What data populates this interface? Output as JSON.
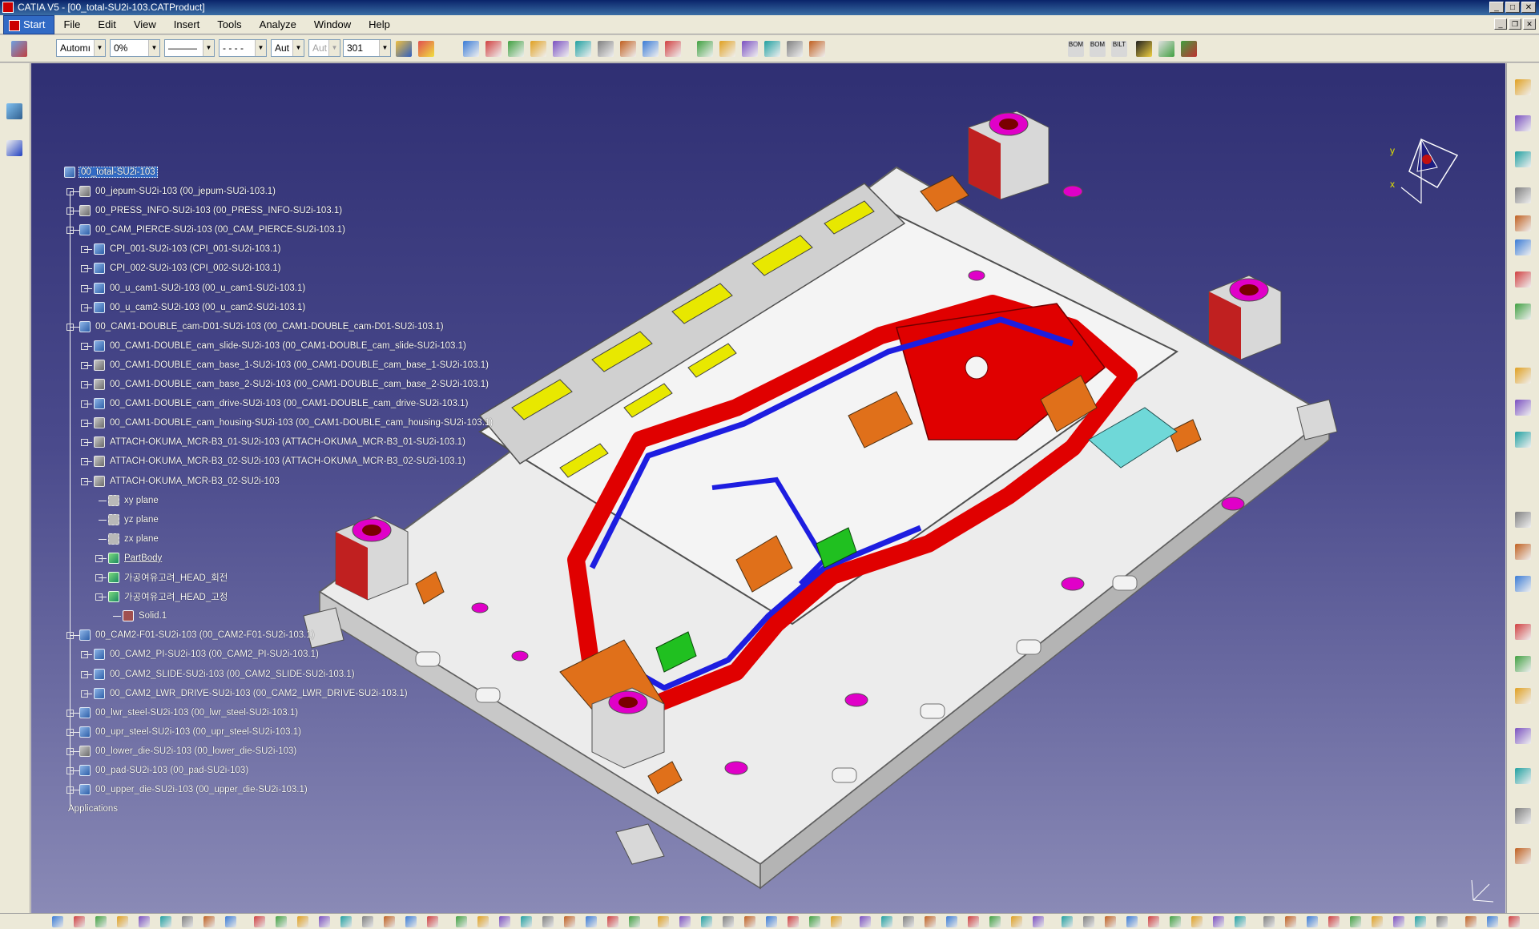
{
  "window": {
    "title": "CATIA V5 - [00_total-SU2i-103.CATProduct]"
  },
  "menu": [
    {
      "label": "Start"
    },
    {
      "label": "File"
    },
    {
      "label": "Edit"
    },
    {
      "label": "View"
    },
    {
      "label": "Insert"
    },
    {
      "label": "Tools"
    },
    {
      "label": "Analyze"
    },
    {
      "label": "Window"
    },
    {
      "label": "Help"
    }
  ],
  "toolbar": {
    "color_value": "Automı",
    "transparency_value": "0%",
    "linetype_value": "———",
    "linedash_value": "- - - -",
    "lineweight_value": "Aut",
    "point_value": "Aut",
    "layer_value": "301",
    "bom_labels": [
      "BOM",
      "BOM",
      "BILT"
    ]
  },
  "tree": {
    "root": "00_total-SU2i-103",
    "nodes": [
      {
        "label": "00_jepum-SU2i-103 (00_jepum-SU2i-103.1)",
        "icon": "part"
      },
      {
        "label": "00_PRESS_INFO-SU2i-103 (00_PRESS_INFO-SU2i-103.1)",
        "icon": "part"
      },
      {
        "label": "00_CAM_PIERCE-SU2i-103 (00_CAM_PIERCE-SU2i-103.1)",
        "icon": "prod"
      },
      {
        "label": "CPI_001-SU2i-103 (CPI_001-SU2i-103.1)",
        "icon": "prod"
      },
      {
        "label": "CPI_002-SU2i-103 (CPI_002-SU2i-103.1)",
        "icon": "prod"
      },
      {
        "label": "00_u_cam1-SU2i-103 (00_u_cam1-SU2i-103.1)",
        "icon": "prod"
      },
      {
        "label": "00_u_cam2-SU2i-103 (00_u_cam2-SU2i-103.1)",
        "icon": "prod"
      },
      {
        "label": "00_CAM1-DOUBLE_cam-D01-SU2i-103 (00_CAM1-DOUBLE_cam-D01-SU2i-103.1)",
        "icon": "prod"
      },
      {
        "label": "00_CAM1-DOUBLE_cam_slide-SU2i-103 (00_CAM1-DOUBLE_cam_slide-SU2i-103.1)",
        "icon": "prod"
      },
      {
        "label": "00_CAM1-DOUBLE_cam_base_1-SU2i-103 (00_CAM1-DOUBLE_cam_base_1-SU2i-103.1)",
        "icon": "part"
      },
      {
        "label": "00_CAM1-DOUBLE_cam_base_2-SU2i-103 (00_CAM1-DOUBLE_cam_base_2-SU2i-103.1)",
        "icon": "part"
      },
      {
        "label": "00_CAM1-DOUBLE_cam_drive-SU2i-103 (00_CAM1-DOUBLE_cam_drive-SU2i-103.1)",
        "icon": "prod"
      },
      {
        "label": "00_CAM1-DOUBLE_cam_housing-SU2i-103 (00_CAM1-DOUBLE_cam_housing-SU2i-103.1)",
        "icon": "part"
      },
      {
        "label": "ATTACH-OKUMA_MCR-B3_01-SU2i-103 (ATTACH-OKUMA_MCR-B3_01-SU2i-103.1)",
        "icon": "part"
      },
      {
        "label": "ATTACH-OKUMA_MCR-B3_02-SU2i-103 (ATTACH-OKUMA_MCR-B3_02-SU2i-103.1)",
        "icon": "part"
      },
      {
        "label": "ATTACH-OKUMA_MCR-B3_02-SU2i-103",
        "icon": "part"
      },
      {
        "label": "xy plane",
        "icon": "plane"
      },
      {
        "label": "yz plane",
        "icon": "plane"
      },
      {
        "label": "zx plane",
        "icon": "plane"
      },
      {
        "label": "PartBody",
        "icon": "body"
      },
      {
        "label": "가공여유고려_HEAD_회전",
        "icon": "body"
      },
      {
        "label": "가공여유고려_HEAD_고정",
        "icon": "body"
      },
      {
        "label": "Solid.1",
        "icon": "solid"
      },
      {
        "label": "00_CAM2-F01-SU2i-103 (00_CAM2-F01-SU2i-103.1)",
        "icon": "prod"
      },
      {
        "label": "00_CAM2_PI-SU2i-103 (00_CAM2_PI-SU2i-103.1)",
        "icon": "prod"
      },
      {
        "label": "00_CAM2_SLIDE-SU2i-103 (00_CAM2_SLIDE-SU2i-103.1)",
        "icon": "prod"
      },
      {
        "label": "00_CAM2_LWR_DRIVE-SU2i-103 (00_CAM2_LWR_DRIVE-SU2i-103.1)",
        "icon": "prod"
      },
      {
        "label": "00_lwr_steel-SU2i-103 (00_lwr_steel-SU2i-103.1)",
        "icon": "prod"
      },
      {
        "label": "00_upr_steel-SU2i-103 (00_upr_steel-SU2i-103.1)",
        "icon": "prod"
      },
      {
        "label": "00_lower_die-SU2i-103 (00_lower_die-SU2i-103)",
        "icon": "part"
      },
      {
        "label": "00_pad-SU2i-103 (00_pad-SU2i-103)",
        "icon": "prod"
      },
      {
        "label": "00_upper_die-SU2i-103 (00_upper_die-SU2i-103.1)",
        "icon": "prod"
      },
      {
        "label": "Applications",
        "icon": "app"
      }
    ]
  },
  "compass": {
    "x_label": "x",
    "y_label": "y"
  },
  "colors": {
    "viewport_top": "#2f2f73",
    "viewport_bottom": "#8a8ab6",
    "die_body": "#e6e6e6",
    "panel_red": "#e00000",
    "trim_blue": "#1d1de0",
    "accent_orange": "#e0701a",
    "accent_yellow": "#e8e800",
    "accent_magenta": "#e000c8",
    "accent_green": "#20c020",
    "accent_cyan": "#6fd8d8",
    "selection": "#316ac5"
  }
}
